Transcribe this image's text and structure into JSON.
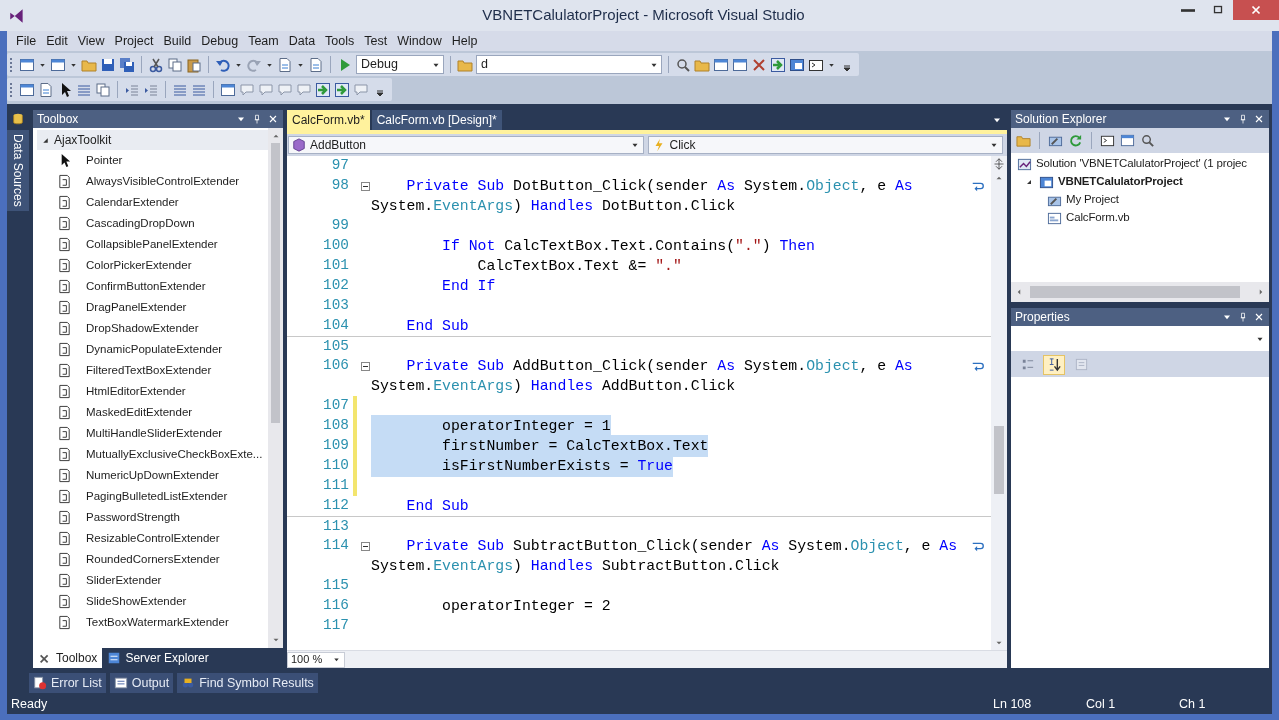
{
  "window": {
    "title": "VBNETCalulatorProject - Microsoft Visual Studio"
  },
  "menu": [
    "File",
    "Edit",
    "View",
    "Project",
    "Build",
    "Debug",
    "Team",
    "Data",
    "Tools",
    "Test",
    "Window",
    "Help"
  ],
  "toolbar": {
    "configuration": "Debug",
    "find": "d"
  },
  "side_tabs": [
    "Data Sources"
  ],
  "toolbox": {
    "title": "Toolbox",
    "group": {
      "label": "AjaxToolkit",
      "expanded": true,
      "items": [
        {
          "kind": "pointer",
          "label": "Pointer"
        },
        {
          "kind": "component",
          "label": "AlwaysVisibleControlExtender"
        },
        {
          "kind": "component",
          "label": "CalendarExtender"
        },
        {
          "kind": "component",
          "label": "CascadingDropDown"
        },
        {
          "kind": "component",
          "label": "CollapsiblePanelExtender"
        },
        {
          "kind": "component",
          "label": "ColorPickerExtender"
        },
        {
          "kind": "component",
          "label": "ConfirmButtonExtender"
        },
        {
          "kind": "component",
          "label": "DragPanelExtender"
        },
        {
          "kind": "component",
          "label": "DropShadowExtender"
        },
        {
          "kind": "component",
          "label": "DynamicPopulateExtender"
        },
        {
          "kind": "component",
          "label": "FilteredTextBoxExtender"
        },
        {
          "kind": "component",
          "label": "HtmlEditorExtender"
        },
        {
          "kind": "component",
          "label": "MaskedEditExtender"
        },
        {
          "kind": "component",
          "label": "MultiHandleSliderExtender"
        },
        {
          "kind": "component",
          "label": "MutuallyExclusiveCheckBoxExte..."
        },
        {
          "kind": "component",
          "label": "NumericUpDownExtender"
        },
        {
          "kind": "component",
          "label": "PagingBulletedListExtender"
        },
        {
          "kind": "component",
          "label": "PasswordStrength"
        },
        {
          "kind": "component",
          "label": "ResizableControlExtender"
        },
        {
          "kind": "component",
          "label": "RoundedCornersExtender"
        },
        {
          "kind": "component",
          "label": "SliderExtender"
        },
        {
          "kind": "component",
          "label": "SlideShowExtender"
        },
        {
          "kind": "component",
          "label": "TextBoxWatermarkExtender"
        }
      ]
    },
    "tabs": [
      {
        "label": "Toolbox",
        "selected": true
      },
      {
        "label": "Server Explorer",
        "selected": false
      }
    ]
  },
  "editor": {
    "tabs": [
      {
        "label": "CalcForm.vb*",
        "selected": true
      },
      {
        "label": "CalcForm.vb [Design]*",
        "selected": false
      }
    ],
    "class_dropdown": "AddButton",
    "method_dropdown": "Click",
    "zoom": "100 %",
    "lines": [
      {
        "number": "97",
        "collapsible": false,
        "modified": false,
        "selected": false,
        "separator": false
      },
      {
        "number": "98",
        "collapsible": true,
        "modified": false,
        "selected": false,
        "separator": false,
        "tokens": [
          {
            "kind": "keyword",
            "text": "    Private Sub"
          },
          {
            "kind": "plain",
            "text": " DotButton_Click(sender "
          },
          {
            "kind": "keyword",
            "text": "As"
          },
          {
            "kind": "plain",
            "text": " System."
          },
          {
            "kind": "type",
            "text": "Object"
          },
          {
            "kind": "plain",
            "text": ", e "
          },
          {
            "kind": "keyword",
            "text": "As"
          }
        ],
        "wrap_tokens": [
          {
            "kind": "plain",
            "text": "System."
          },
          {
            "kind": "type",
            "text": "EventArgs"
          },
          {
            "kind": "plain",
            "text": ") "
          },
          {
            "kind": "keyword",
            "text": "Handles"
          },
          {
            "kind": "plain",
            "text": " DotButton.Click"
          }
        ]
      },
      {
        "number": "99",
        "collapsible": false,
        "modified": false,
        "selected": false,
        "separator": false
      },
      {
        "number": "100",
        "collapsible": false,
        "modified": false,
        "selected": false,
        "separator": false,
        "tokens": [
          {
            "kind": "keyword",
            "text": "        If Not"
          },
          {
            "kind": "plain",
            "text": " CalcTextBox.Text.Contains("
          },
          {
            "kind": "string",
            "text": "\".\""
          },
          {
            "kind": "plain",
            "text": ") "
          },
          {
            "kind": "keyword",
            "text": "Then"
          }
        ]
      },
      {
        "number": "101",
        "collapsible": false,
        "modified": false,
        "selected": false,
        "separator": false,
        "tokens": [
          {
            "kind": "plain",
            "text": "            CalcTextBox.Text &= "
          },
          {
            "kind": "string",
            "text": "\".\""
          }
        ]
      },
      {
        "number": "102",
        "collapsible": false,
        "modified": false,
        "selected": false,
        "separator": false,
        "tokens": [
          {
            "kind": "keyword",
            "text": "        End If"
          }
        ]
      },
      {
        "number": "103",
        "collapsible": false,
        "modified": false,
        "selected": false,
        "separator": false
      },
      {
        "number": "104",
        "collapsible": false,
        "modified": false,
        "selected": false,
        "separator": false,
        "tokens": [
          {
            "kind": "keyword",
            "text": "    End Sub"
          }
        ]
      },
      {
        "number": "105",
        "collapsible": false,
        "modified": false,
        "selected": false,
        "separator": true
      },
      {
        "number": "106",
        "collapsible": true,
        "modified": false,
        "selected": false,
        "separator": false,
        "tokens": [
          {
            "kind": "keyword",
            "text": "    Private Sub"
          },
          {
            "kind": "plain",
            "text": " AddButton_Click(sender "
          },
          {
            "kind": "keyword",
            "text": "As"
          },
          {
            "kind": "plain",
            "text": " System."
          },
          {
            "kind": "type",
            "text": "Object"
          },
          {
            "kind": "plain",
            "text": ", e "
          },
          {
            "kind": "keyword",
            "text": "As"
          }
        ],
        "wrap_tokens": [
          {
            "kind": "plain",
            "text": "System."
          },
          {
            "kind": "type",
            "text": "EventArgs"
          },
          {
            "kind": "plain",
            "text": ") "
          },
          {
            "kind": "keyword",
            "text": "Handles"
          },
          {
            "kind": "plain",
            "text": " AddButton.Click"
          }
        ]
      },
      {
        "number": "107",
        "collapsible": false,
        "modified": true,
        "selected": false,
        "separator": false
      },
      {
        "number": "108",
        "collapsible": false,
        "modified": true,
        "selected": true,
        "separator": false,
        "tokens": [
          {
            "kind": "plain",
            "text": "        operatorInteger = 1"
          }
        ]
      },
      {
        "number": "109",
        "collapsible": false,
        "modified": true,
        "selected": true,
        "separator": false,
        "tokens": [
          {
            "kind": "plain",
            "text": "        firstNumber = CalcTextBox.Text"
          }
        ]
      },
      {
        "number": "110",
        "collapsible": false,
        "modified": true,
        "selected": true,
        "separator": false,
        "tokens": [
          {
            "kind": "plain",
            "text": "        isFirstNumberExists = "
          },
          {
            "kind": "keyword",
            "text": "True"
          }
        ]
      },
      {
        "number": "111",
        "collapsible": false,
        "modified": true,
        "selected": false,
        "separator": false
      },
      {
        "number": "112",
        "collapsible": false,
        "modified": false,
        "selected": false,
        "separator": false,
        "tokens": [
          {
            "kind": "keyword",
            "text": "    End Sub"
          }
        ]
      },
      {
        "number": "113",
        "collapsible": false,
        "modified": false,
        "selected": false,
        "separator": true
      },
      {
        "number": "114",
        "collapsible": true,
        "modified": false,
        "selected": false,
        "separator": false,
        "tokens": [
          {
            "kind": "keyword",
            "text": "    Private Sub"
          },
          {
            "kind": "plain",
            "text": " SubtractButton_Click(sender "
          },
          {
            "kind": "keyword",
            "text": "As"
          },
          {
            "kind": "plain",
            "text": " System."
          },
          {
            "kind": "type",
            "text": "Object"
          },
          {
            "kind": "plain",
            "text": ", e "
          },
          {
            "kind": "keyword",
            "text": "As"
          }
        ],
        "wrap_tokens": [
          {
            "kind": "plain",
            "text": "System."
          },
          {
            "kind": "type",
            "text": "EventArgs"
          },
          {
            "kind": "plain",
            "text": ") "
          },
          {
            "kind": "keyword",
            "text": "Handles"
          },
          {
            "kind": "plain",
            "text": " SubtractButton.Click"
          }
        ]
      },
      {
        "number": "115",
        "collapsible": false,
        "modified": false,
        "selected": false,
        "separator": false
      },
      {
        "number": "116",
        "collapsible": false,
        "modified": false,
        "selected": false,
        "separator": false,
        "tokens": [
          {
            "kind": "plain",
            "text": "        operatorInteger = 2"
          }
        ]
      },
      {
        "number": "117",
        "collapsible": false,
        "modified": false,
        "selected": false,
        "separator": false
      }
    ]
  },
  "solution_explorer": {
    "title": "Solution Explorer",
    "tree": [
      {
        "kind": "solution",
        "label": "Solution 'VBNETCalulatorProject' (1 projec",
        "children": [
          {
            "kind": "project",
            "label": "VBNETCalulatorProject",
            "startup": true,
            "expanded": true,
            "children": [
              {
                "kind": "properties",
                "label": "My Project"
              },
              {
                "kind": "form",
                "label": "CalcForm.vb"
              }
            ]
          }
        ]
      }
    ]
  },
  "properties": {
    "title": "Properties",
    "buttons": [
      {
        "kind": "categorized",
        "selected": false,
        "disabled": false
      },
      {
        "kind": "alphabetical",
        "selected": true,
        "disabled": false
      },
      {
        "kind": "pages",
        "selected": false,
        "disabled": true
      }
    ]
  },
  "bottom_tabs": [
    {
      "kind": "errors",
      "label": "Error List"
    },
    {
      "kind": "output",
      "label": "Output"
    },
    {
      "kind": "symbols",
      "label": "Find Symbol Results"
    }
  ],
  "status_bar": {
    "message": "Ready",
    "line": "Ln 108",
    "column": "Col 1",
    "char": "Ch 1"
  }
}
